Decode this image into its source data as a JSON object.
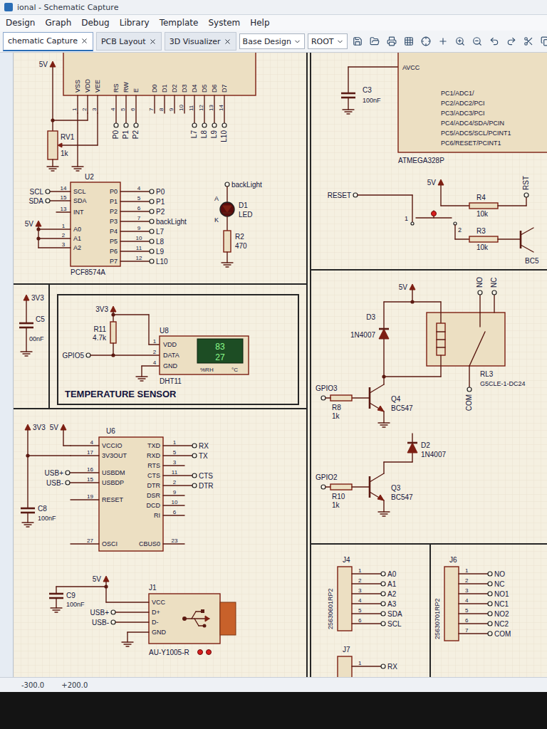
{
  "window": {
    "title": "ional - Schematic Capture"
  },
  "menu": [
    "Design",
    "Graph",
    "Debug",
    "Library",
    "Template",
    "System",
    "Help"
  ],
  "tabs": [
    {
      "label": "chematic Capture",
      "selected": true
    },
    {
      "label": "PCB Layout",
      "selected": false
    },
    {
      "label": "3D Visualizer",
      "selected": false
    }
  ],
  "toolbar": {
    "variant": "Base Design",
    "sheet": "ROOT"
  },
  "status": {
    "x": "-300.0",
    "y": "+200.0"
  },
  "lcd": {
    "power": "5V",
    "pot": {
      "ref": "RV1",
      "value": "1k"
    },
    "pins": [
      {
        "name": "VSS",
        "num": "1",
        "net": ""
      },
      {
        "name": "VDD",
        "num": "2",
        "net": ""
      },
      {
        "name": "VEE",
        "num": "3",
        "net": ""
      },
      {
        "name": "RS",
        "num": "4",
        "net": "P0"
      },
      {
        "name": "RW",
        "num": "5",
        "net": "P1"
      },
      {
        "name": "E",
        "num": "6",
        "net": "P2"
      },
      {
        "name": "D0",
        "num": "7",
        "net": ""
      },
      {
        "name": "D1",
        "num": "8",
        "net": ""
      },
      {
        "name": "D2",
        "num": "9",
        "net": ""
      },
      {
        "name": "D3",
        "num": "10",
        "net": ""
      },
      {
        "name": "D4",
        "num": "11",
        "net": "L7"
      },
      {
        "name": "D5",
        "num": "12",
        "net": "L8"
      },
      {
        "name": "D6",
        "num": "13",
        "net": "L9"
      },
      {
        "name": "D7",
        "num": "14",
        "net": "L10"
      }
    ]
  },
  "expander": {
    "ref": "U2",
    "value": "PCF8574A",
    "power": "5V",
    "left": [
      {
        "name": "SCL",
        "num": "14",
        "net": "SCL"
      },
      {
        "name": "SDA",
        "num": "15",
        "net": "SDA"
      },
      {
        "name": "INT",
        "num": "13",
        "net": ""
      },
      {
        "name": "A0",
        "num": "1",
        "net": ""
      },
      {
        "name": "A1",
        "num": "2",
        "net": ""
      },
      {
        "name": "A2",
        "num": "3",
        "net": ""
      }
    ],
    "right": [
      {
        "name": "P0",
        "num": "4",
        "net": "P0"
      },
      {
        "name": "P1",
        "num": "5",
        "net": "P1"
      },
      {
        "name": "P2",
        "num": "6",
        "net": "P2"
      },
      {
        "name": "P3",
        "num": "7",
        "net": "backLight"
      },
      {
        "name": "P4",
        "num": "9",
        "net": "L7"
      },
      {
        "name": "P5",
        "num": "10",
        "net": "L8"
      },
      {
        "name": "P6",
        "num": "11",
        "net": "L9"
      },
      {
        "name": "P7",
        "num": "12",
        "net": "L10"
      }
    ]
  },
  "led": {
    "ref": "D1",
    "value": "LED",
    "net": "backLight",
    "anode": "A",
    "cathode": "K",
    "resistor": {
      "ref": "R2",
      "value": "470"
    }
  },
  "decoupling": {
    "ref": "C5",
    "value": "00nF",
    "power": "3V3"
  },
  "temperature": {
    "title": "TEMPERATURE SENSOR",
    "power": "3V3",
    "net": "GPIO5",
    "resistor": {
      "ref": "R11",
      "value": "4.7k"
    },
    "sensor": {
      "ref": "U8",
      "value": "DHT11",
      "pins": [
        {
          "name": "VDD",
          "num": "1"
        },
        {
          "name": "DATA",
          "num": "2"
        },
        {
          "name": "GND",
          "num": "4"
        }
      ],
      "humidity": "83",
      "temperature": "27",
      "humidity_unit": "%RH",
      "temperature_unit": "°C"
    }
  },
  "usb_uart": {
    "ref": "U6",
    "power_left": "3V3",
    "power_right": "5V",
    "cap": {
      "ref": "C8",
      "value": "100nF"
    },
    "left": [
      {
        "name": "VCCIO",
        "num": "4",
        "net": ""
      },
      {
        "name": "3V3OUT",
        "num": "17",
        "net": ""
      },
      {
        "name": "USBDM",
        "num": "16",
        "net": "USB+"
      },
      {
        "name": "USBDP",
        "num": "15",
        "net": "USB-"
      },
      {
        "name": "RESET",
        "num": "19",
        "net": ""
      },
      {
        "name": "OSCI",
        "num": "27",
        "net": ""
      }
    ],
    "right": [
      {
        "name": "TXD",
        "num": "1",
        "net": "RX"
      },
      {
        "name": "RXD",
        "num": "5",
        "net": "TX"
      },
      {
        "name": "RTS",
        "num": "3",
        "net": ""
      },
      {
        "name": "CTS",
        "num": "11",
        "net": "CTS"
      },
      {
        "name": "DTR",
        "num": "2",
        "net": "DTR"
      },
      {
        "name": "DSR",
        "num": "9",
        "net": ""
      },
      {
        "name": "DCD",
        "num": "10",
        "net": ""
      },
      {
        "name": "RI",
        "num": "6",
        "net": ""
      },
      {
        "name": "CBUS0",
        "num": "23",
        "net": ""
      }
    ]
  },
  "usb_jack": {
    "ref": "J1",
    "value": "AU-Y1005-R",
    "power": "5V",
    "cap": {
      "ref": "C9",
      "value": "100nF"
    },
    "pins": [
      {
        "name": "VCC",
        "net": ""
      },
      {
        "name": "D+",
        "net": "USB+"
      },
      {
        "name": "D-",
        "net": "USB-"
      },
      {
        "name": "GND",
        "net": ""
      }
    ]
  },
  "mcu": {
    "name": "ATMEGA328P",
    "supply_pin": "AVCC",
    "cap": {
      "ref": "C3",
      "value": "100nF"
    },
    "pins": [
      "PC1/ADC1/",
      "PC2/ADC2/PCI",
      "PC3/ADC3/PCI",
      "PC4/ADC4/SDA/PCIN",
      "PC5/ADC5/SCL/PCINT1",
      "PC6/RESET/PCINT1"
    ]
  },
  "reset": {
    "net": "RESET",
    "power": "5V",
    "pullup": {
      "ref": "R4",
      "value": "10k"
    },
    "base_resistor": {
      "ref": "R3",
      "value": "10k"
    },
    "switch_pins": [
      "1",
      "2"
    ],
    "out_net": "RST",
    "transistor": "BC5"
  },
  "relay": {
    "net": "GPIO3",
    "power": "5V",
    "resistor": {
      "ref": "R8",
      "value": "1k"
    },
    "transistor": {
      "ref": "Q4",
      "value": "BC547"
    },
    "diode": {
      "ref": "D3",
      "value": "1N4007"
    },
    "relay": {
      "ref": "RL3",
      "value": "G5CLE-1-DC24"
    },
    "contacts": [
      "NO",
      "NC",
      "COM"
    ]
  },
  "driver2": {
    "net": "GPIO2",
    "resistor": {
      "ref": "R10",
      "value": "1k"
    },
    "transistor": {
      "ref": "Q3",
      "value": "BC547"
    },
    "diode": {
      "ref": "D2",
      "value": "1N4007"
    }
  },
  "j4": {
    "ref": "J4",
    "value": "25630601RP2",
    "pins": [
      {
        "num": "1",
        "net": "A0"
      },
      {
        "num": "2",
        "net": "A1"
      },
      {
        "num": "3",
        "net": "A2"
      },
      {
        "num": "4",
        "net": "A3"
      },
      {
        "num": "5",
        "net": "SDA"
      },
      {
        "num": "6",
        "net": "SCL"
      }
    ]
  },
  "j6": {
    "ref": "J6",
    "value": "25630701RP2",
    "pins": [
      {
        "num": "1",
        "net": "NO"
      },
      {
        "num": "2",
        "net": "NC"
      },
      {
        "num": "3",
        "net": "NO1"
      },
      {
        "num": "4",
        "net": "NC1"
      },
      {
        "num": "5",
        "net": "NO2"
      },
      {
        "num": "6",
        "net": "NC2"
      },
      {
        "num": "7",
        "net": "COM"
      }
    ]
  },
  "j7": {
    "ref": "J7",
    "pins": [
      {
        "num": "1",
        "net": "RX"
      }
    ]
  }
}
